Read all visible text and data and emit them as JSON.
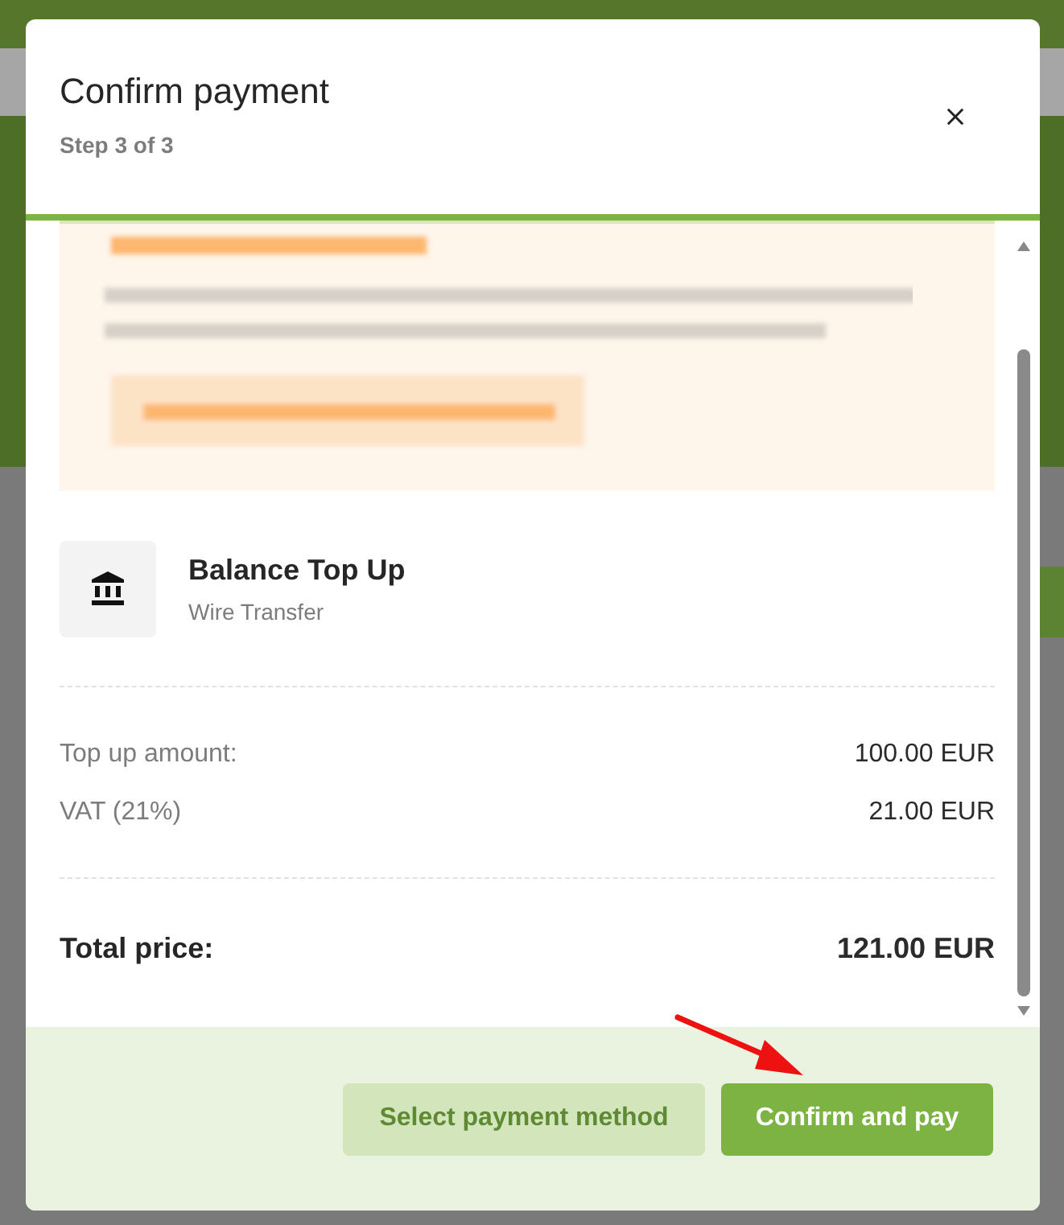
{
  "modal": {
    "title": "Confirm payment",
    "subtitle": "Step 3 of 3"
  },
  "item": {
    "title": "Balance Top Up",
    "subtitle": "Wire Transfer"
  },
  "lines": [
    {
      "label": "Top up amount:",
      "value": "100.00 EUR",
      "kind": "line"
    },
    {
      "label": "VAT (21%)",
      "value": "21.00 EUR",
      "kind": "line"
    },
    {
      "label": "Total price:",
      "value": "121.00 EUR",
      "kind": "total"
    }
  ],
  "buttons": [
    {
      "label": "Select payment method",
      "kind": "secondary"
    },
    {
      "label": "Confirm and pay",
      "kind": "primary"
    }
  ]
}
